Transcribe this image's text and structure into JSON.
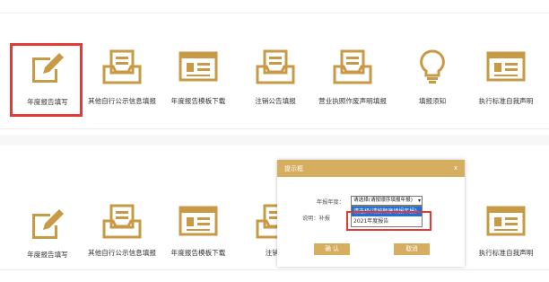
{
  "items_top": [
    {
      "label": "年度报告填写",
      "icon": "pencil-edit-icon"
    },
    {
      "label": "其他自行公示信息填报",
      "icon": "inbox-tray-icon"
    },
    {
      "label": "年度报告模板下载",
      "icon": "document-template-icon"
    },
    {
      "label": "注销公告填报",
      "icon": "inbox-tray-icon"
    },
    {
      "label": "营业执照作废声明填报",
      "icon": "inbox-tray-icon"
    },
    {
      "label": "填报须知",
      "icon": "lightbulb-icon"
    },
    {
      "label": "执行标准自我声明",
      "icon": "document-template-icon"
    }
  ],
  "items_bottom": [
    {
      "label": "年度报告填写",
      "icon": "pencil-edit-icon"
    },
    {
      "label": "其他自行公示信息填报",
      "icon": "inbox-tray-icon"
    },
    {
      "label": "年度报告模板下载",
      "icon": "document-template-icon"
    },
    {
      "label": "注销公",
      "icon": "inbox-tray-icon"
    },
    {
      "label": "执行标准自我声明",
      "icon": "document-template-icon"
    }
  ],
  "modal": {
    "title": "提示框",
    "close": "x",
    "year_label": "年报年度：",
    "select_value": "请选择(请按顺序填报年报)",
    "options": [
      "请选择(请按顺序填报年报)",
      "2021年度报告"
    ],
    "note_label": "说明：补报",
    "confirm": "确 认",
    "cancel": "取消"
  },
  "colors": {
    "accent": "#d6ae60",
    "icon": "#c99a45",
    "highlight": "#e53935"
  }
}
